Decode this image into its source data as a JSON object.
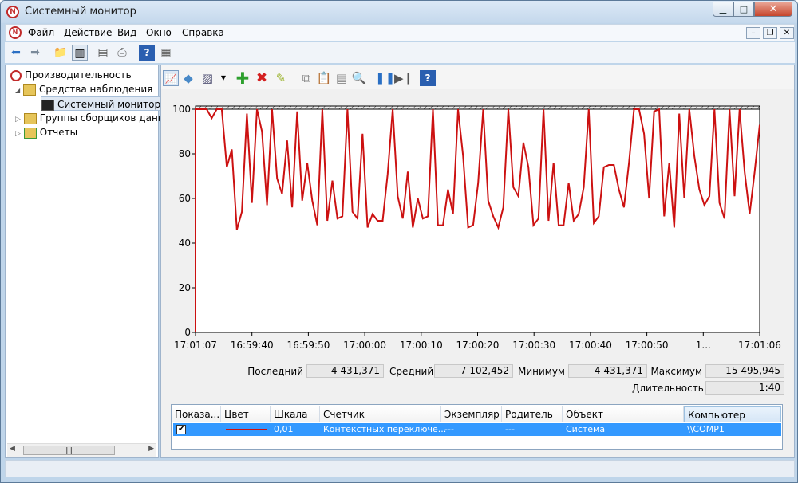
{
  "window": {
    "title": "Системный монитор"
  },
  "menu": [
    "Файл",
    "Действие",
    "Вид",
    "Окно",
    "Справка"
  ],
  "tree": {
    "root": "Производительность",
    "monitoring": "Средства наблюдения",
    "system_monitor": "Системный монитор",
    "collector_groups": "Группы сборщиков данн",
    "reports": "Отчеты"
  },
  "stats": {
    "last_label": "Последний",
    "last_value": "4 431,371",
    "avg_label": "Средний",
    "avg_value": "7 102,452",
    "min_label": "Минимум",
    "min_value": "4 431,371",
    "max_label": "Максимум",
    "max_value": "15 495,945",
    "duration_label": "Длительность",
    "duration_value": "1:40"
  },
  "table": {
    "headers": [
      "Показа...",
      "Цвет",
      "Шкала",
      "Счетчик",
      "Экземпляр",
      "Родитель",
      "Объект",
      "Компьютер"
    ],
    "row": {
      "scale": "0,01",
      "counter": "Контекстных переключе...",
      "instance": "---",
      "parent": "---",
      "object": "Система",
      "computer": "\\\\COMP1"
    }
  },
  "colors": {
    "line": "#cc1111",
    "selection": "#3399ff"
  },
  "chart_data": {
    "type": "line",
    "ylim": [
      0,
      100
    ],
    "yticks": [
      0,
      20,
      40,
      60,
      80,
      100
    ],
    "xticks": [
      "17:01:07",
      "16:59:40",
      "16:59:50",
      "17:00:00",
      "17:00:10",
      "17:00:20",
      "17:00:30",
      "17:00:40",
      "17:00:50",
      "1...",
      "17:01:06"
    ],
    "series": [
      {
        "color": "#cc1111",
        "values": [
          100,
          96,
          100,
          100,
          74,
          82,
          46,
          54,
          98,
          58,
          100,
          90,
          57,
          100,
          69,
          62,
          86,
          56,
          99,
          59,
          76,
          59,
          48,
          100,
          50,
          68,
          51,
          52,
          100,
          54,
          51,
          89,
          47,
          53,
          50,
          50,
          71,
          100,
          61,
          51,
          72,
          47,
          60,
          51,
          52,
          100,
          48,
          48,
          64,
          53,
          100,
          79,
          47,
          48,
          67,
          100,
          59,
          52,
          47,
          56,
          100,
          65,
          61,
          85,
          74,
          48,
          51,
          100,
          50,
          76,
          48,
          48,
          67,
          50,
          53,
          65,
          100,
          49,
          52,
          74,
          75,
          75,
          64,
          56,
          76,
          100,
          100,
          89,
          60,
          99,
          100,
          52,
          76,
          47,
          98,
          60,
          100,
          79,
          64,
          57,
          61,
          100,
          58,
          51,
          100,
          61,
          100,
          72,
          53,
          72,
          93
        ]
      }
    ]
  }
}
